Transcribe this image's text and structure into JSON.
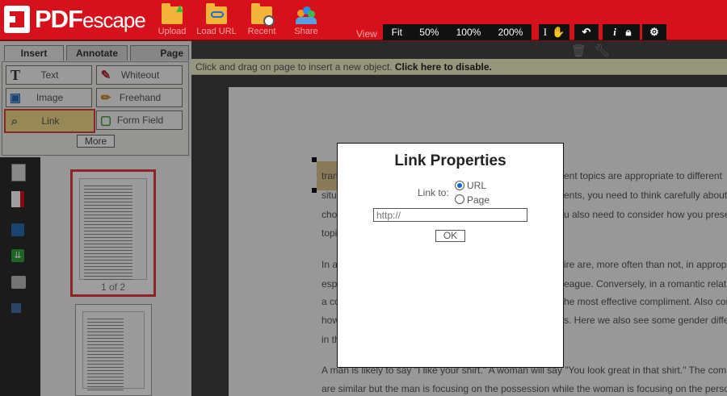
{
  "app": {
    "logo_text": "PDFescape"
  },
  "toolbar": {
    "upload": "Upload",
    "load_url": "Load URL",
    "recent": "Recent",
    "share": "Share",
    "view_label": "View",
    "zoom": [
      "Fit",
      "50%",
      "100%",
      "200%"
    ],
    "tools": [
      "text-cursor-icon",
      "hand-icon",
      "undo-icon",
      "info-icon",
      "lock-icon",
      "gear-icon"
    ]
  },
  "tabs": [
    "Insert",
    "Annotate",
    "Page"
  ],
  "insert_tools": [
    {
      "label": "Text",
      "icon": "text-icon"
    },
    {
      "label": "Whiteout",
      "icon": "whiteout-icon"
    },
    {
      "label": "Image",
      "icon": "image-icon"
    },
    {
      "label": "Freehand",
      "icon": "pencil-icon"
    },
    {
      "label": "Link",
      "icon": "link-icon",
      "selected": true
    },
    {
      "label": "Form Field",
      "icon": "form-field-icon"
    }
  ],
  "more_label": "More",
  "thumbnails": {
    "page_label": "1 of 2"
  },
  "hint": {
    "text": "Click and drag on page to insert a new object.",
    "action": "Click here to disable."
  },
  "document_lines": [
    "tran",
    "situ",
    "cho",
    "topi",
    "In a",
    "esp",
    "a co",
    "how",
    "in th",
    "A man is likely to say \"I like your shirt.\" A woman will say \"You look great in that shirt.\" The complim",
    "are similar but the man is focusing on the possession while the woman is focusing on the person's"
  ],
  "document_right_lines": [
    "ent topics are appropriate to different",
    "ents, you need to think carefully about",
    "u also need to consider how you presen",
    "ire are, more often than not, in appropri",
    "eague. Conversely, in a romantic relatio",
    "he most effective compliment. Also cons",
    "s. Here we also see some gender differe"
  ],
  "dialog": {
    "title": "Link Properties",
    "link_to_label": "Link to:",
    "option_url": "URL",
    "option_page": "Page",
    "url_placeholder": "http://",
    "ok_label": "OK"
  },
  "colors": {
    "brand_red": "#d7111b",
    "selected_tool": "#f3de89",
    "radio_blue": "#1566d6"
  }
}
